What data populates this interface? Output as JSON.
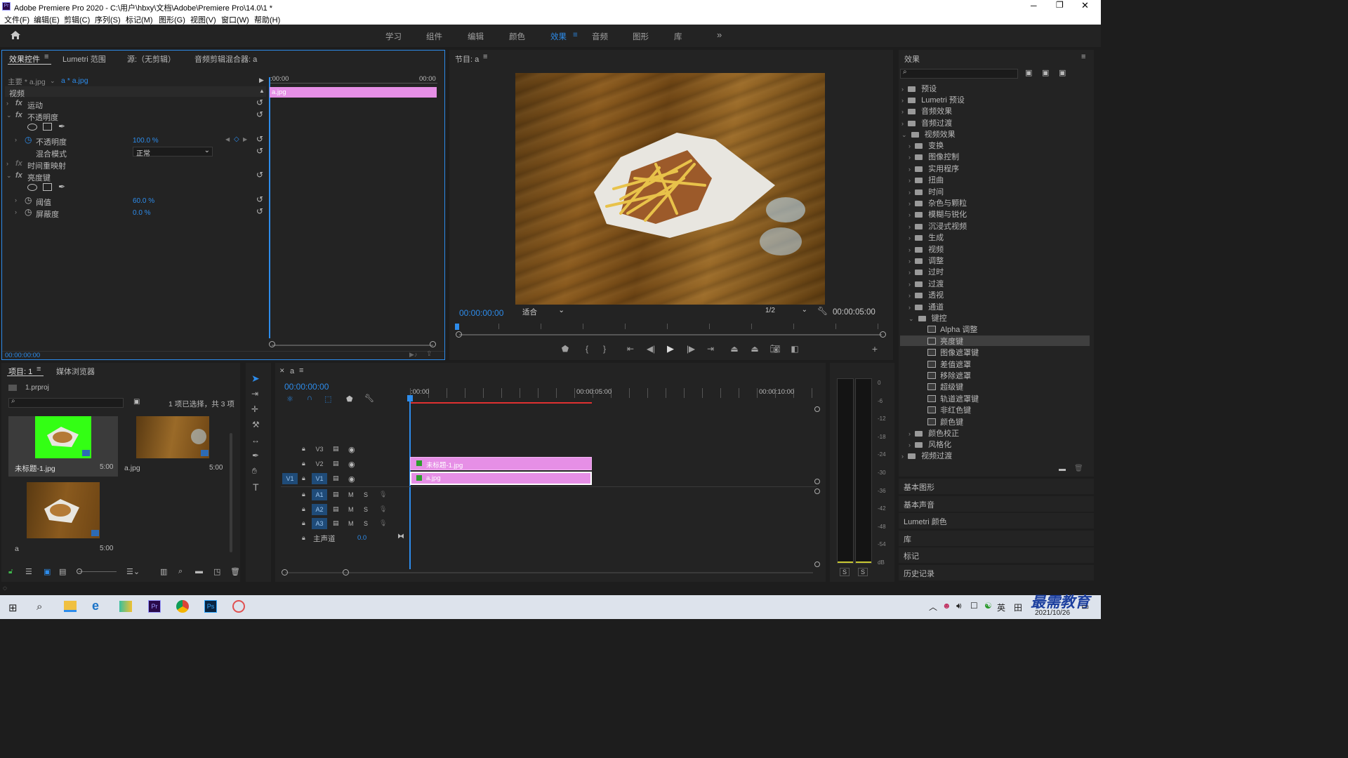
{
  "titlebar": {
    "title": "Adobe Premiere Pro 2020 - C:\\用户\\hbxy\\文档\\Adobe\\Premiere Pro\\14.0\\1 *"
  },
  "menu": [
    "文件(F)",
    "编辑(E)",
    "剪辑(C)",
    "序列(S)",
    "标记(M)",
    "图形(G)",
    "视图(V)",
    "窗口(W)",
    "帮助(H)"
  ],
  "workspaces": [
    "学习",
    "组件",
    "编辑",
    "颜色",
    "效果",
    "音频",
    "图形",
    "库"
  ],
  "active_workspace": "效果",
  "effect_controls": {
    "tabs": [
      "效果控件",
      "Lumetri 范围",
      "源:（无剪辑）",
      "音频剪辑混合器: a"
    ],
    "master": "主要 * a.jpg",
    "clip": "a * a.jpg",
    "timecode_start": ":00:00",
    "timecode_end": "00:00",
    "clip_bar": "a.jpg",
    "section": "视频",
    "motion": "运动",
    "opacity": "不透明度",
    "opacity_label": "不透明度",
    "opacity_value": "100.0 %",
    "blend_label": "混合模式",
    "blend_value": "正常",
    "time_remap": "时间重映射",
    "luma_key": "亮度键",
    "threshold_label": "阈值",
    "threshold_value": "60.0 %",
    "cutoff_label": "屏蔽度",
    "cutoff_value": "0.0 %",
    "footer_tc": "00:00:00:00"
  },
  "program": {
    "title": "节目: a",
    "timecode": "00:00:00:00",
    "fit": "适合",
    "quality": "1/2",
    "duration": "00:00:05:00"
  },
  "effects_panel": {
    "title": "效果",
    "top_folders": [
      "预设",
      "Lumetri 预设",
      "音频效果",
      "音频过渡",
      "视频效果"
    ],
    "video_sub": [
      "变换",
      "图像控制",
      "实用程序",
      "扭曲",
      "时间",
      "杂色与颗粒",
      "模糊与锐化",
      "沉浸式视频",
      "生成",
      "视频",
      "调整",
      "过时",
      "过渡",
      "透视",
      "通道",
      "键控"
    ],
    "keying": [
      "Alpha 调整",
      "亮度键",
      "图像遮罩键",
      "差值遮罩",
      "移除遮罩",
      "超级键",
      "轨道遮罩键",
      "非红色键",
      "颜色键"
    ],
    "after": [
      "颜色校正",
      "风格化"
    ],
    "last": "视频过渡",
    "collapsed_panels": [
      "基本图形",
      "基本声音",
      "Lumetri 颜色",
      "库",
      "标记",
      "历史记录"
    ]
  },
  "project": {
    "tabs": [
      "项目: 1",
      "媒体浏览器"
    ],
    "file": "1.prproj",
    "status": "1 项已选择，共 3 项",
    "items": [
      {
        "name": "未标题-1.jpg",
        "dur": "5:00"
      },
      {
        "name": "a.jpg",
        "dur": "5:00"
      },
      {
        "name": "a",
        "dur": "5:00"
      }
    ]
  },
  "timeline": {
    "seq": "a",
    "timecode": "00:00:00:00",
    "ruler": [
      ":00:00",
      "00:00:05:00",
      "00:00:10:00"
    ],
    "tracks_v": [
      "V3",
      "V2",
      "V1"
    ],
    "tracks_a": [
      "A1",
      "A2",
      "A3"
    ],
    "master": "主声道",
    "master_val": "0.0",
    "clip_v2": "未标题-1.jpg",
    "clip_v1": "a.jpg",
    "source_patch": "V1"
  },
  "meter": {
    "labels": [
      "0",
      "-6",
      "-12",
      "-18",
      "-24",
      "-30",
      "-36",
      "-42",
      "-48",
      "-54",
      "dB"
    ],
    "solo": [
      "S",
      "S"
    ]
  },
  "taskbar": {
    "ime": "英",
    "date": "2021/10/26",
    "watermark": "最需教育"
  },
  "colors": {
    "accent": "#2d8ceb",
    "clip": "#e68fe6",
    "panel": "#232323"
  }
}
